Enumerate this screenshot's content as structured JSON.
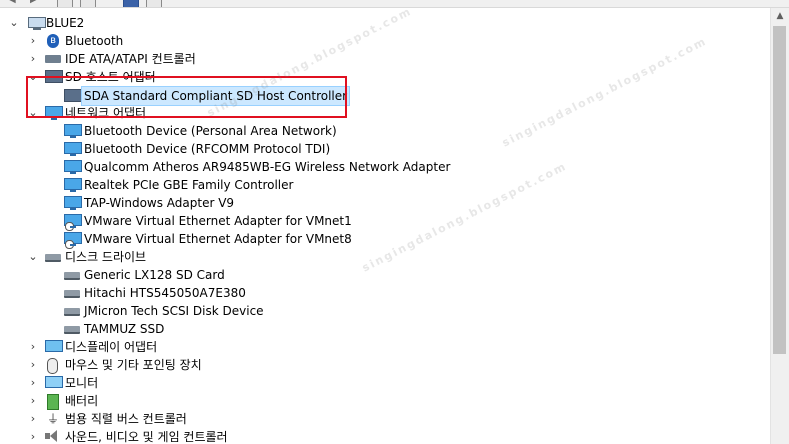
{
  "tree": {
    "root": "BLUE2",
    "items": [
      {
        "label": "Bluetooth",
        "icon": "bluetooth-icon"
      },
      {
        "label": "IDE ATA/ATAPI 컨트롤러",
        "icon": "ide-controller-icon"
      },
      {
        "label": "SD 호스트 어댑터",
        "icon": "sd-host-adapter-icon"
      },
      {
        "label": "SDA Standard Compliant SD Host Controller",
        "icon": "sd-host-controller-icon"
      },
      {
        "label": "네트워크 어댑터",
        "icon": "network-adapter-icon"
      },
      {
        "label": "Bluetooth Device (Personal Area Network)",
        "icon": "network-card-icon"
      },
      {
        "label": "Bluetooth Device (RFCOMM Protocol TDI)",
        "icon": "network-card-icon"
      },
      {
        "label": "Qualcomm Atheros AR9485WB-EG Wireless Network Adapter",
        "icon": "network-card-icon"
      },
      {
        "label": "Realtek PCIe GBE Family Controller",
        "icon": "network-card-icon"
      },
      {
        "label": "TAP-Windows Adapter V9",
        "icon": "network-card-icon"
      },
      {
        "label": "VMware Virtual Ethernet Adapter for VMnet1",
        "icon": "virtual-network-card-icon"
      },
      {
        "label": "VMware Virtual Ethernet Adapter for VMnet8",
        "icon": "virtual-network-card-icon"
      },
      {
        "label": "디스크 드라이브",
        "icon": "disk-drive-icon"
      },
      {
        "label": "Generic LX128 SD Card",
        "icon": "disk-icon"
      },
      {
        "label": "Hitachi HTS545050A7E380",
        "icon": "disk-icon"
      },
      {
        "label": "JMicron Tech SCSI Disk Device",
        "icon": "disk-icon"
      },
      {
        "label": "TAMMUZ SSD",
        "icon": "disk-icon"
      },
      {
        "label": "디스플레이 어댑터",
        "icon": "display-adapter-icon"
      },
      {
        "label": "마우스 및 기타 포인팅 장치",
        "icon": "mouse-icon"
      },
      {
        "label": "모니터",
        "icon": "monitor-icon"
      },
      {
        "label": "배터리",
        "icon": "battery-icon"
      },
      {
        "label": "범용 직렬 버스 컨트롤러",
        "icon": "usb-icon"
      },
      {
        "label": "사운드, 비디오 및 게임 컨트롤러",
        "icon": "sound-icon"
      }
    ]
  },
  "selected": "SDA Standard Compliant SD Host Controller",
  "watermark": "singingdalong.blogspot.com",
  "colors": {
    "highlight": "#e01020",
    "selection": "#cce8ff"
  }
}
